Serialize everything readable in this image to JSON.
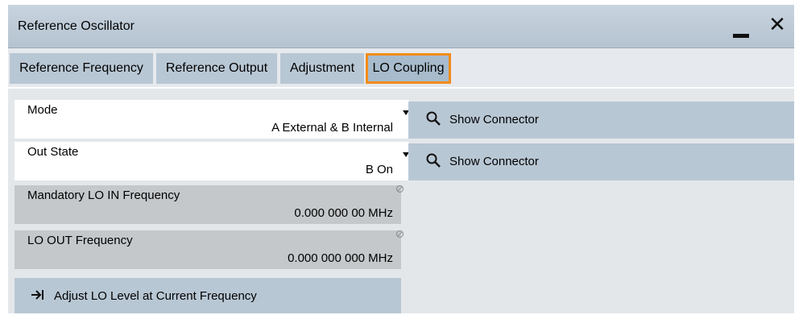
{
  "window": {
    "title": "Reference Oscillator"
  },
  "tabs": [
    {
      "label": "Reference Frequency",
      "active": false
    },
    {
      "label": "Reference Output",
      "active": false
    },
    {
      "label": "Adjustment",
      "active": false
    },
    {
      "label": "LO Coupling",
      "active": true
    }
  ],
  "fields": {
    "mode": {
      "label": "Mode",
      "value": "A External & B Internal"
    },
    "out_state": {
      "label": "Out State",
      "value": "B On"
    },
    "lo_in": {
      "label": "Mandatory LO IN Frequency",
      "value": "0.000 000 00 MHz"
    },
    "lo_out": {
      "label": "LO OUT Frequency",
      "value": "0.000 000 000 MHz"
    }
  },
  "buttons": {
    "show_connector_1": "Show Connector",
    "show_connector_2": "Show Connector",
    "adjust_lo": "Adjust LO Level at Current Frequency"
  },
  "icons": {
    "minimize": "minimize-icon",
    "close": "close-icon",
    "search": "magnifier-icon",
    "adjust": "arrow-to-bar-icon",
    "readonly": "not-editable-icon"
  },
  "colors": {
    "active_tab_border": "#f28c1a",
    "button_bg": "#b8c7d4",
    "readonly_bg": "#c4c8cb"
  }
}
